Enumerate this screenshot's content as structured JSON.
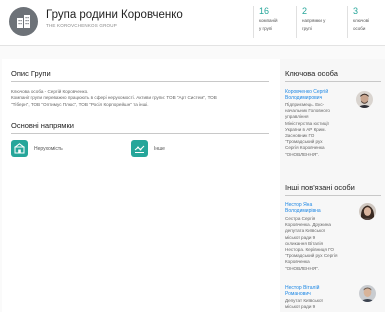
{
  "header": {
    "title": "Група родини Коровченко",
    "subtitle": "THE KOROVCHENKOS GROUP",
    "stats": [
      {
        "num": "16",
        "label1": "компаній",
        "label2": "у групі"
      },
      {
        "num": "2",
        "label1": "напрямки у",
        "label2": "групі"
      },
      {
        "num": "3",
        "label1": "ключові",
        "label2": "особи"
      }
    ]
  },
  "description": {
    "title": "Опис Групи",
    "lines": [
      "Ключова особа - Сергій Коровченко.",
      "Компанії групи переважно працюють в сфері нерухомості. Активи групи: ТОВ \"Арт Систем\", ТОВ",
      "\"Тіберн\", ТОВ \"Оптимус Плюс\", ТОВ \"Росіл Корпорейшн\" та інші."
    ]
  },
  "directions": {
    "title": "Основні напрямки",
    "items": [
      {
        "label": "Нерухомість",
        "icon": "real-estate-icon"
      },
      {
        "label": "Інше",
        "icon": "other-icon"
      }
    ]
  },
  "key_person": {
    "title": "Ключова особа",
    "name_lines": [
      "Коровченко Сергій",
      "Володимирович"
    ],
    "desc_lines": [
      "Підприємець. Екс-",
      "начальник Головного",
      "управління",
      "Міністерства юстиції",
      "України в АР Крим.",
      "Засновник ГО",
      "\"Громадський рух",
      "Сергія Коровченка",
      "\"ОНОВЛЕННЯ\"."
    ]
  },
  "related": {
    "title": "Інші пов'язані особи",
    "people": [
      {
        "name_lines": [
          "Нестор Яна",
          "Володимирівна"
        ],
        "desc_lines": [
          "Сестра Сергія",
          "Коровченка. Дружина",
          "депутата Київської",
          "міської ради 9",
          "скликання Віталія",
          "Нестора. Керівниця ГО",
          "\"Громадський рух Сергія",
          "Коровченка",
          "\"ОНОВЛЕННЯ\"."
        ]
      },
      {
        "name_lines": [
          "Нестор Віталій",
          "Романович"
        ],
        "desc_lines": [
          "Депутат Київської",
          "міської ради 9"
        ]
      }
    ]
  },
  "colors": {
    "accent": "#26a69a",
    "link": "#1e88e5"
  }
}
